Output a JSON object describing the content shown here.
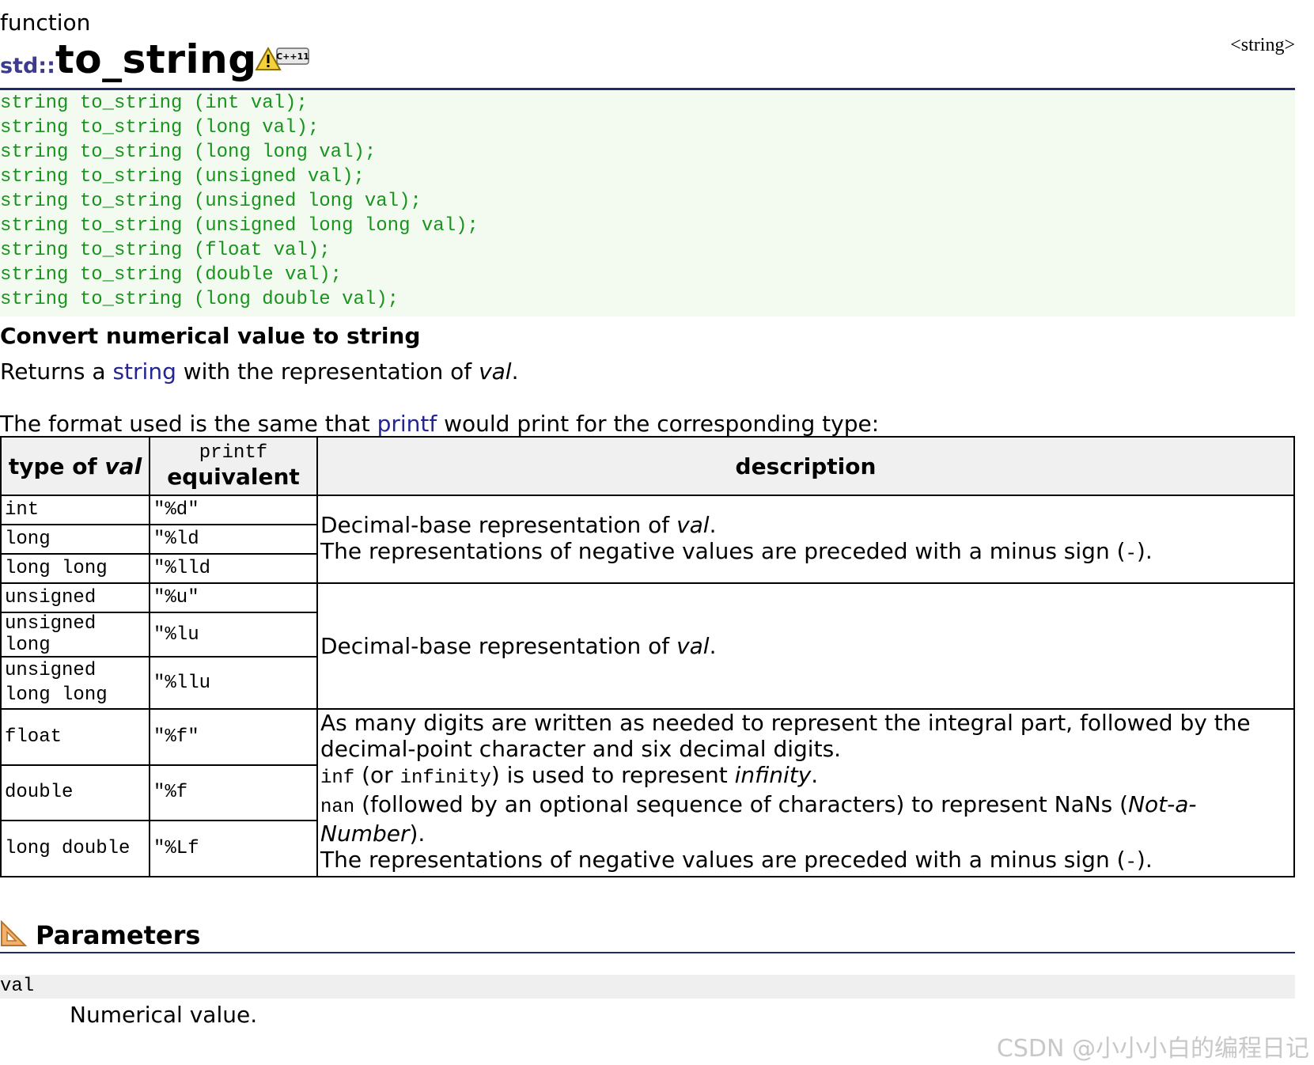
{
  "header": {
    "kind": "function",
    "namespace": "std::",
    "name": "to_string",
    "badge_text": "C++11",
    "header_ref": "<string>"
  },
  "prototypes": [
    "string to_string (int val);",
    "string to_string (long val);",
    "string to_string (long long val);",
    "string to_string (unsigned val);",
    "string to_string (unsigned long val);",
    "string to_string (unsigned long long val);",
    "string to_string (float val);",
    "string to_string (double val);",
    "string to_string (long double val);"
  ],
  "summary": {
    "heading": "Convert numerical value to string",
    "returns_prefix": "Returns a ",
    "returns_link": "string",
    "returns_middle": " with the representation of ",
    "returns_val": "val",
    "returns_end": ".",
    "format_prefix": "The format used is the same that ",
    "format_link": "printf",
    "format_suffix": " would print for the corresponding type:"
  },
  "table": {
    "col1_prefix": "type of ",
    "col1_val": "val",
    "col2_top": "printf",
    "col2_bottom": "equivalent",
    "col3": "description",
    "rows": [
      {
        "type": "int",
        "fmt": "\"%d\""
      },
      {
        "type": "long",
        "fmt": "\"%ld"
      },
      {
        "type": "long long",
        "fmt": "\"%lld"
      },
      {
        "type": "unsigned",
        "fmt": "\"%u\""
      },
      {
        "type": "unsigned long",
        "fmt": "\"%lu"
      },
      {
        "type": "unsigned long long",
        "fmt": "\"%llu"
      },
      {
        "type": "float",
        "fmt": "\"%f\""
      },
      {
        "type": "double",
        "fmt": "\"%f"
      },
      {
        "type": "long double",
        "fmt": "\"%Lf"
      }
    ],
    "desc1": {
      "line1_prefix": "Decimal-base representation of ",
      "line1_val": "val",
      "line1_end": ".",
      "line2_prefix": "The representations of negative values are preceded with a minus sign (",
      "line2_code": "-",
      "line2_end": ")."
    },
    "desc2": {
      "prefix": "Decimal-base representation of ",
      "val": "val",
      "end": "."
    },
    "desc3": {
      "line1": "As many digits are written as needed to represent the integral part, followed by the decimal-point character and six decimal digits.",
      "inf_code": "inf",
      "inf_mid1": " (or ",
      "infinity_code": "infinity",
      "inf_mid2": ") is used to represent ",
      "inf_em": "infinity",
      "inf_end": ".",
      "nan_code": "nan",
      "nan_mid": " (followed by an optional sequence of characters) to represent NaNs (",
      "nan_em": "Not-a-Number",
      "nan_end": ").",
      "neg_prefix": "The representations of negative values are preceded with a minus sign (",
      "neg_code": "-",
      "neg_end": ")."
    }
  },
  "parameters": {
    "heading": "Parameters",
    "name": "val",
    "description": "Numerical value."
  },
  "watermark": "CSDN @小小小白的编程日记",
  "colors": {
    "namespace": "#3b3b8f",
    "link": "#242493",
    "prototype_text": "#18941e",
    "prototype_bg": "#f3fbf1",
    "rule": "#1f2a6b"
  }
}
